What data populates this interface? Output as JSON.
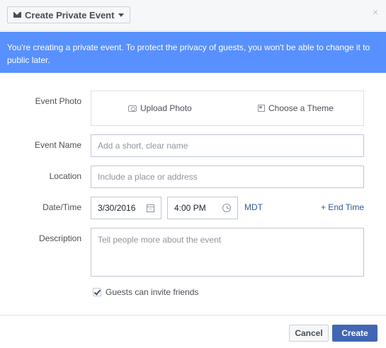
{
  "header": {
    "event_type_label": "Create Private Event",
    "close_glyph": "×"
  },
  "banner": {
    "text": "You're creating a private event. To protect the privacy of guests, you won't be able to change it to public later."
  },
  "form": {
    "photo": {
      "label": "Event Photo",
      "upload_label": "Upload Photo",
      "theme_label": "Choose a Theme"
    },
    "name": {
      "label": "Event Name",
      "value": "",
      "placeholder": "Add a short, clear name"
    },
    "location": {
      "label": "Location",
      "value": "",
      "placeholder": "Include a place or address"
    },
    "datetime": {
      "label": "Date/Time",
      "date": "3/30/2016",
      "time": "4:00 PM",
      "timezone": "MDT",
      "end_time_link": "+ End Time"
    },
    "description": {
      "label": "Description",
      "value": "",
      "placeholder": "Tell people more about the event"
    },
    "guests_invite": {
      "label": "Guests can invite friends",
      "checked": true
    }
  },
  "footer": {
    "cancel_label": "Cancel",
    "create_label": "Create"
  },
  "colors": {
    "banner_bg": "#5890ff",
    "primary_button": "#4267b2",
    "link": "#365899"
  },
  "icons": {
    "type_button": "envelope-icon",
    "type_caret": "caret-down-icon",
    "close": "close-icon",
    "upload": "camera-icon",
    "theme": "theme-icon",
    "date": "calendar-icon",
    "time": "clock-icon",
    "checkbox": "checkmark-icon"
  }
}
